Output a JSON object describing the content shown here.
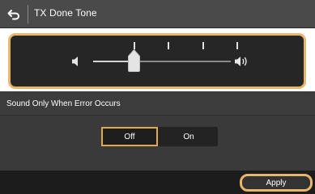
{
  "header": {
    "back_icon": "back-arrow-icon",
    "title": "TX Done Tone"
  },
  "volume": {
    "min_icon": "speaker-low-icon",
    "max_icon": "speaker-high-icon",
    "level": 2,
    "max_level": 5
  },
  "error_option": {
    "label": "Sound Only When Error Occurs",
    "options": [
      "Off",
      "On"
    ],
    "selected": "Off"
  },
  "footer": {
    "apply_label": "Apply"
  },
  "colors": {
    "accent": "#e8b66a",
    "header_bg": "#4a4a4a",
    "panel_bg": "#262626",
    "footer_bg": "#1c1c1c"
  }
}
